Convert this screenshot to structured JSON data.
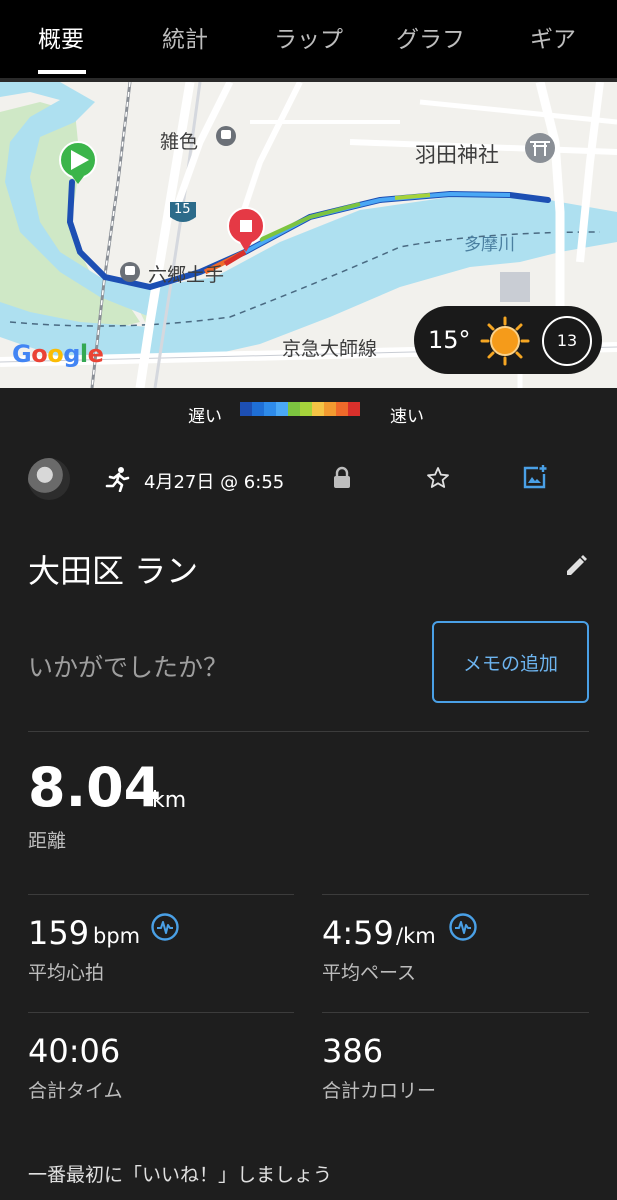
{
  "tabs": [
    "概要",
    "統計",
    "ラップ",
    "グラフ",
    "ギア"
  ],
  "map": {
    "labels": {
      "zoshiki": "雑色",
      "haneda_shrine": "羽田神社",
      "route15": "15",
      "tamagawa": "多摩川",
      "rokugo": "六郷土手",
      "keikyu": "京急大師線"
    },
    "google_logo": "Google"
  },
  "weather": {
    "temperature": "15°",
    "wind": "13"
  },
  "legend": {
    "slow": "遅い",
    "fast": "速い",
    "colors": [
      "#1d4fb3",
      "#1f6fd6",
      "#2e8bea",
      "#4aa8f5",
      "#7cc440",
      "#a6d33b",
      "#f5c445",
      "#f29a30",
      "#ef6a2a",
      "#d9302b"
    ]
  },
  "activity": {
    "date": "4月27日 @ 6:55",
    "title": "大田区 ラン",
    "prompt": "いかがでしたか？",
    "memo_button": "メモの追加"
  },
  "stats": {
    "distance": {
      "value": "8.04",
      "unit": "km",
      "label": "距離"
    },
    "heart_rate": {
      "value": "159",
      "unit": "bpm",
      "label": "平均心拍"
    },
    "pace": {
      "value": "4:59",
      "unit": "/km",
      "label": "平均ペース"
    },
    "time": {
      "value": "40:06",
      "label": "合計タイム"
    },
    "calories": {
      "value": "386",
      "label": "合計カロリー"
    }
  },
  "like_prompt": "一番最初に「いいね！」しましょう"
}
